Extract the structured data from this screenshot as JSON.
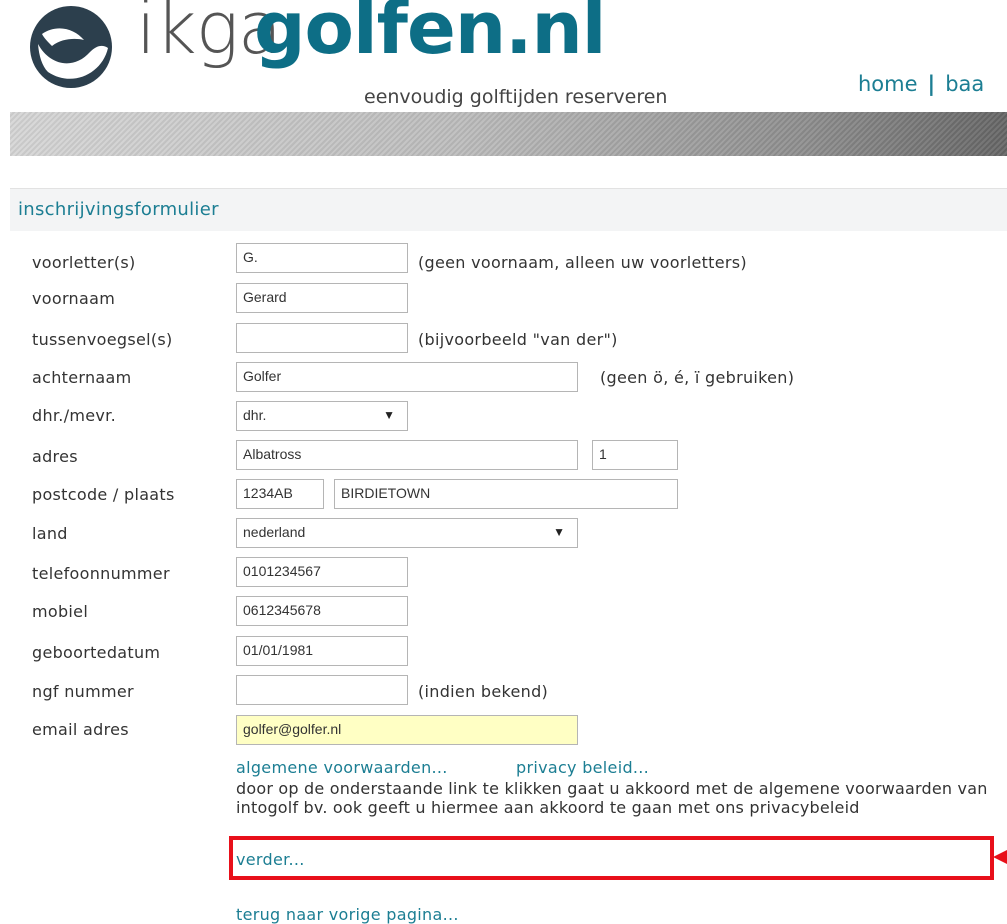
{
  "header": {
    "logo": {
      "prefix": "ikga",
      "brand": "golfen.nl",
      "tagline": "eenvoudig golftijden reserveren"
    },
    "nav": {
      "home": "home",
      "next_partial": "baa"
    }
  },
  "form": {
    "title": "inschrijvingsformulier",
    "fields": {
      "voorletters": {
        "label": "voorletter(s)",
        "value": "G.",
        "hint": "(geen voornaam, alleen uw voorletters)"
      },
      "voornaam": {
        "label": "voornaam",
        "value": "Gerard"
      },
      "tussenvoegsel": {
        "label": "tussenvoegsel(s)",
        "value": "",
        "hint": "(bijvoorbeeld \"van der\")"
      },
      "achternaam": {
        "label": "achternaam",
        "value": "Golfer",
        "hint": "(geen ö, é, ï gebruiken)"
      },
      "aanhef": {
        "label": "dhr./mevr.",
        "value": "dhr."
      },
      "adres": {
        "label": "adres",
        "street": "Albatross",
        "number": "1"
      },
      "postcode_plaats": {
        "label": "postcode / plaats",
        "postcode": "1234AB",
        "plaats": "BIRDIETOWN"
      },
      "land": {
        "label": "land",
        "value": "nederland"
      },
      "telefoon": {
        "label": "telefoonnummer",
        "value": "0101234567"
      },
      "mobiel": {
        "label": "mobiel",
        "value": "0612345678"
      },
      "geboortedatum": {
        "label": "geboortedatum",
        "value": "01/01/1981"
      },
      "ngf": {
        "label": "ngf nummer",
        "value": "",
        "hint": "(indien bekend)"
      },
      "email": {
        "label": "email adres",
        "value": "golfer@golfer.nl"
      }
    },
    "links": {
      "voorwaarden": "algemene voorwaarden...",
      "privacy": "privacy beleid...",
      "verder": "verder...",
      "terug": "terug naar vorige pagina..."
    },
    "notice": "door op de onderstaande link te klikken gaat u akkoord met de algemene voorwaarden van intogolf bv. ook geeft u hiermee aan akkoord te gaan met ons privacybeleid"
  },
  "colors": {
    "accent": "#1c7e93",
    "highlight_input": "#ffffc4",
    "annotation": "#e8101a"
  }
}
